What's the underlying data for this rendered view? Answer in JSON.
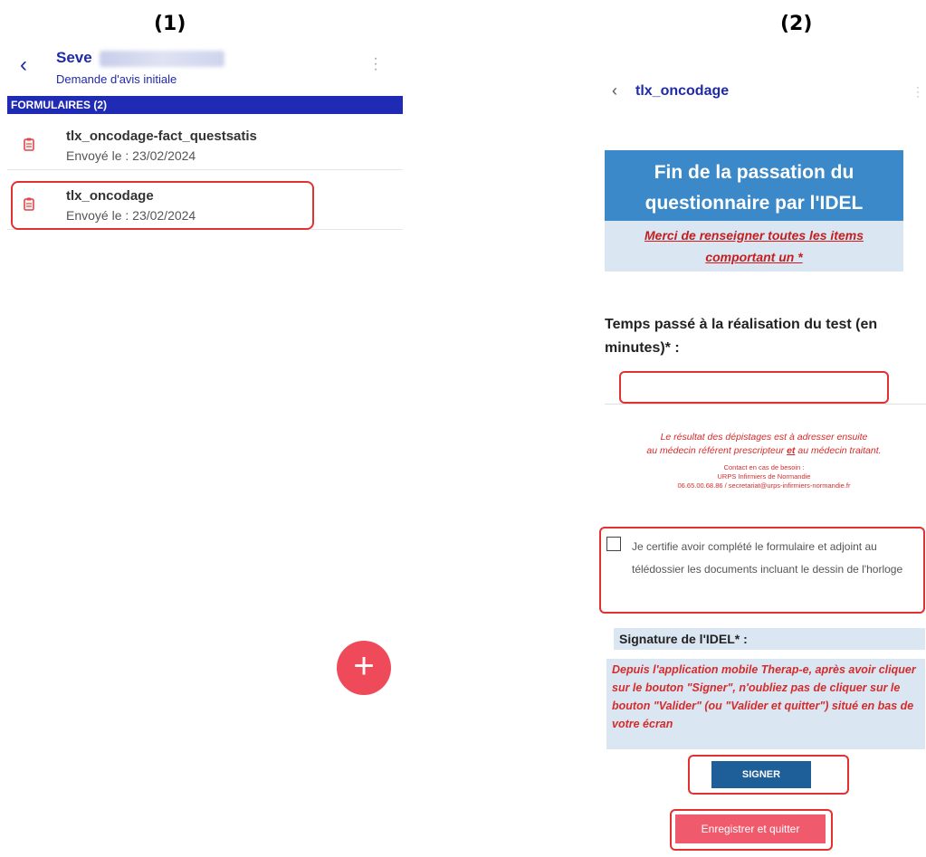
{
  "labels": {
    "screen1": "(1)",
    "screen2": "(2)"
  },
  "screen1": {
    "patient_name_visible": "Seve",
    "subtitle": "Demande d'avis initiale",
    "section_header": "FORMULAIRES (2)",
    "items": [
      {
        "title": "tlx_oncodage-fact_questsatis",
        "date": "Envoyé le : 23/02/2024"
      },
      {
        "title": "tlx_oncodage",
        "date": "Envoyé le : 23/02/2024"
      }
    ],
    "fab_label": "+"
  },
  "screen2": {
    "title": "tlx_oncodage",
    "banner_line1": "Fin de la passation du",
    "banner_line2": "questionnaire par l'IDEL",
    "notice_line1": "Merci de renseigner toutes les items",
    "notice_line2": "comportant un *",
    "question_label": "Temps passé à la réalisation du test (en minutes)* :",
    "time_value": "",
    "red_note_line1": "Le résultat des dépistages est à adresser ensuite",
    "red_note_line2_a": "au médecin référent prescripteur ",
    "red_note_line2_b": "et",
    "red_note_line2_c": " au médecin traitant.",
    "contact_line1": "Contact en cas de besoin :",
    "contact_line2": "URPS Infirmiers de Normandie",
    "contact_line3": "06.65.00.68.86 / secretariat@urps-infirmiers-normandie.fr",
    "certify_text": "Je certifie avoir complété le formulaire et adjoint au télédossier les documents incluant le dessin de l'horloge",
    "certify_checked": false,
    "signature_label": "Signature de l'IDEL* :",
    "signature_info": "Depuis l'application mobile Therap-e, après avoir cliquer sur le bouton \"Signer\", n'oubliez pas de cliquer sur le bouton \"Valider\" (ou \"Valider et quitter\") situé en bas de votre écran",
    "sign_button": "SIGNER",
    "save_button": "Enregistrer et quitter"
  },
  "colors": {
    "brand_blue": "#1f2aa8",
    "section_bar": "#1f2ab5",
    "banner": "#3b89c9",
    "highlight_red": "#e53030",
    "fab": "#ef4a5a"
  }
}
